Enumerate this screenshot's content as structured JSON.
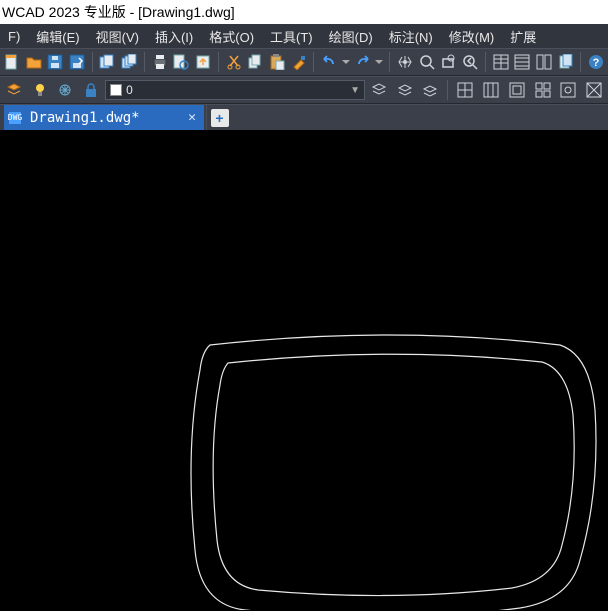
{
  "title": "WCAD 2023 专业版 - [Drawing1.dwg]",
  "menu": {
    "file": "F)",
    "edit": "编辑(E)",
    "view": "视图(V)",
    "insert": "插入(I)",
    "format": "格式(O)",
    "tools": "工具(T)",
    "draw": "绘图(D)",
    "dimension": "标注(N)",
    "modify": "修改(M)",
    "extend": "扩展"
  },
  "layer": {
    "name": "0"
  },
  "tab": {
    "label": "Drawing1.dwg*",
    "icon_text": "DWG"
  }
}
